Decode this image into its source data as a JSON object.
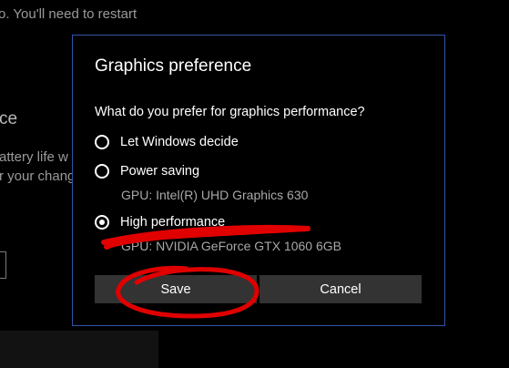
{
  "background": {
    "restart_text": "o. You'll need to restart",
    "heading_fragment": "ce",
    "line1_fragment": "attery life w",
    "line2_fragment": "r your chang"
  },
  "dialog": {
    "title": "Graphics preference",
    "question": "What do you prefer for graphics performance?",
    "options": [
      {
        "label": "Let Windows decide",
        "selected": false,
        "gpu": ""
      },
      {
        "label": "Power saving",
        "selected": false,
        "gpu": "GPU: Intel(R) UHD Graphics 630"
      },
      {
        "label": "High performance",
        "selected": true,
        "gpu": "GPU: NVIDIA GeForce GTX 1060 6GB"
      }
    ],
    "buttons": {
      "save_label": "Save",
      "cancel_label": "Cancel"
    }
  },
  "colors": {
    "dialog_border": "#2f55a9",
    "button_bg": "#333333",
    "annotation_red": "#e00000"
  }
}
